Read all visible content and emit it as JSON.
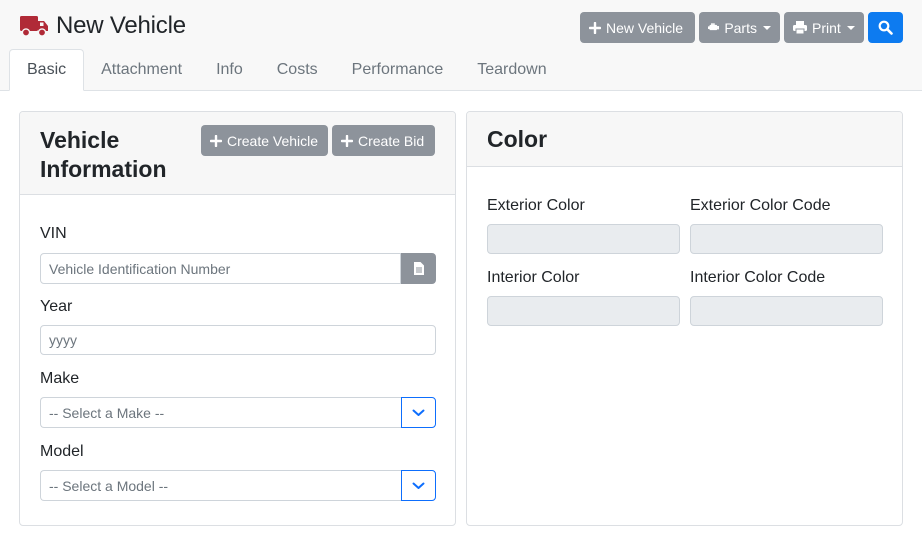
{
  "header": {
    "title": "New Vehicle",
    "icon": "truck-icon",
    "accent_color": "#b02a37"
  },
  "toolbar": {
    "new_vehicle_label": "New Vehicle",
    "parts_label": "Parts",
    "print_label": "Print",
    "search_icon": "search-icon"
  },
  "tabs": [
    {
      "label": "Basic",
      "active": true
    },
    {
      "label": "Attachment",
      "active": false
    },
    {
      "label": "Info",
      "active": false
    },
    {
      "label": "Costs",
      "active": false
    },
    {
      "label": "Performance",
      "active": false
    },
    {
      "label": "Teardown",
      "active": false
    }
  ],
  "vehicle_info": {
    "title": "Vehicle Information",
    "create_vehicle_label": "Create Vehicle",
    "create_bid_label": "Create Bid",
    "vin": {
      "label": "VIN",
      "placeholder": "Vehicle Identification Number",
      "value": ""
    },
    "year": {
      "label": "Year",
      "placeholder": "yyyy",
      "value": ""
    },
    "make": {
      "label": "Make",
      "selected": "-- Select a Make --"
    },
    "model": {
      "label": "Model",
      "selected": "-- Select a Model --"
    }
  },
  "color": {
    "title": "Color",
    "exterior_color": {
      "label": "Exterior Color",
      "value": ""
    },
    "exterior_color_code": {
      "label": "Exterior Color Code",
      "value": ""
    },
    "interior_color": {
      "label": "Interior Color",
      "value": ""
    },
    "interior_color_code": {
      "label": "Interior Color Code",
      "value": ""
    }
  }
}
